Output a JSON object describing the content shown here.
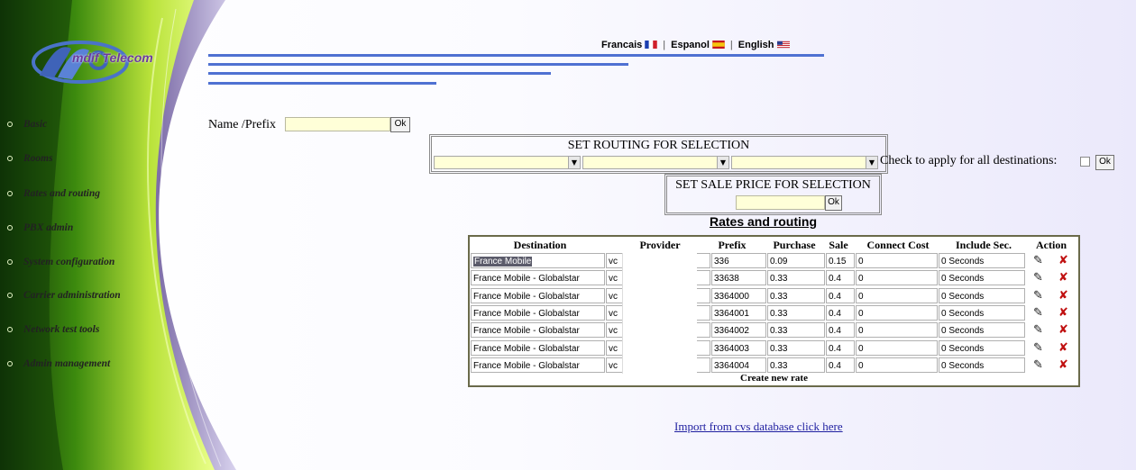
{
  "logo": {
    "text": "mdif Telecom"
  },
  "sidebar": {
    "items": [
      {
        "label": "Basic"
      },
      {
        "label": "Rooms"
      },
      {
        "label": "Rates and routing"
      },
      {
        "label": "PBX admin"
      },
      {
        "label": "System configuration"
      },
      {
        "label": "Carrier administration"
      },
      {
        "label": "Network test tools"
      },
      {
        "label": "Admin management"
      }
    ]
  },
  "languages": [
    {
      "label": "Francais",
      "flag": "fr-flag"
    },
    {
      "label": "Espanol",
      "flag": "es-flag"
    },
    {
      "label": "English",
      "flag": "us-flag"
    }
  ],
  "search": {
    "label": "Name /Prefix",
    "value": "",
    "ok": "Ok"
  },
  "routing": {
    "title": "SET ROUTING FOR SELECTION",
    "apply_label": "Check to apply for all destinations:",
    "ok": "Ok"
  },
  "sale_price": {
    "title": "SET SALE PRICE FOR SELECTION",
    "value": "",
    "ok": "Ok"
  },
  "table": {
    "title": "Rates and routing",
    "headers": [
      "Destination",
      "Provider",
      "Prefix",
      "Purchase",
      "Sale",
      "Connect Cost",
      "Include Sec.",
      "Action"
    ],
    "rows": [
      {
        "destination": "France Mobile",
        "provider": "vc",
        "prefix": "336",
        "purchase": "0.09",
        "sale": "0.15",
        "connect": "0",
        "include": "0 Seconds"
      },
      {
        "destination": "France Mobile - Globalstar",
        "provider": "vc",
        "prefix": "33638",
        "purchase": "0.33",
        "sale": "0.4",
        "connect": "0",
        "include": "0 Seconds"
      },
      {
        "destination": "France Mobile - Globalstar",
        "provider": "vc",
        "prefix": "3364000",
        "purchase": "0.33",
        "sale": "0.4",
        "connect": "0",
        "include": "0 Seconds"
      },
      {
        "destination": "France Mobile - Globalstar",
        "provider": "vc",
        "prefix": "3364001",
        "purchase": "0.33",
        "sale": "0.4",
        "connect": "0",
        "include": "0 Seconds"
      },
      {
        "destination": "France Mobile - Globalstar",
        "provider": "vc",
        "prefix": "3364002",
        "purchase": "0.33",
        "sale": "0.4",
        "connect": "0",
        "include": "0 Seconds"
      },
      {
        "destination": "France Mobile - Globalstar",
        "provider": "vc",
        "prefix": "3364003",
        "purchase": "0.33",
        "sale": "0.4",
        "connect": "0",
        "include": "0 Seconds"
      },
      {
        "destination": "France Mobile - Globalstar",
        "provider": "vc",
        "prefix": "3364004",
        "purchase": "0.33",
        "sale": "0.4",
        "connect": "0",
        "include": "0 Seconds"
      }
    ],
    "create_label": "Create new rate",
    "edit_icon": "pencil-icon",
    "delete_icon": "x-delete-icon"
  },
  "import_link": "Import from cvs database click here",
  "colors": {
    "accent_line": "#4f71d2",
    "input_bg": "#ffffd8",
    "delete": "#c01010",
    "link": "#1f1fa0"
  }
}
